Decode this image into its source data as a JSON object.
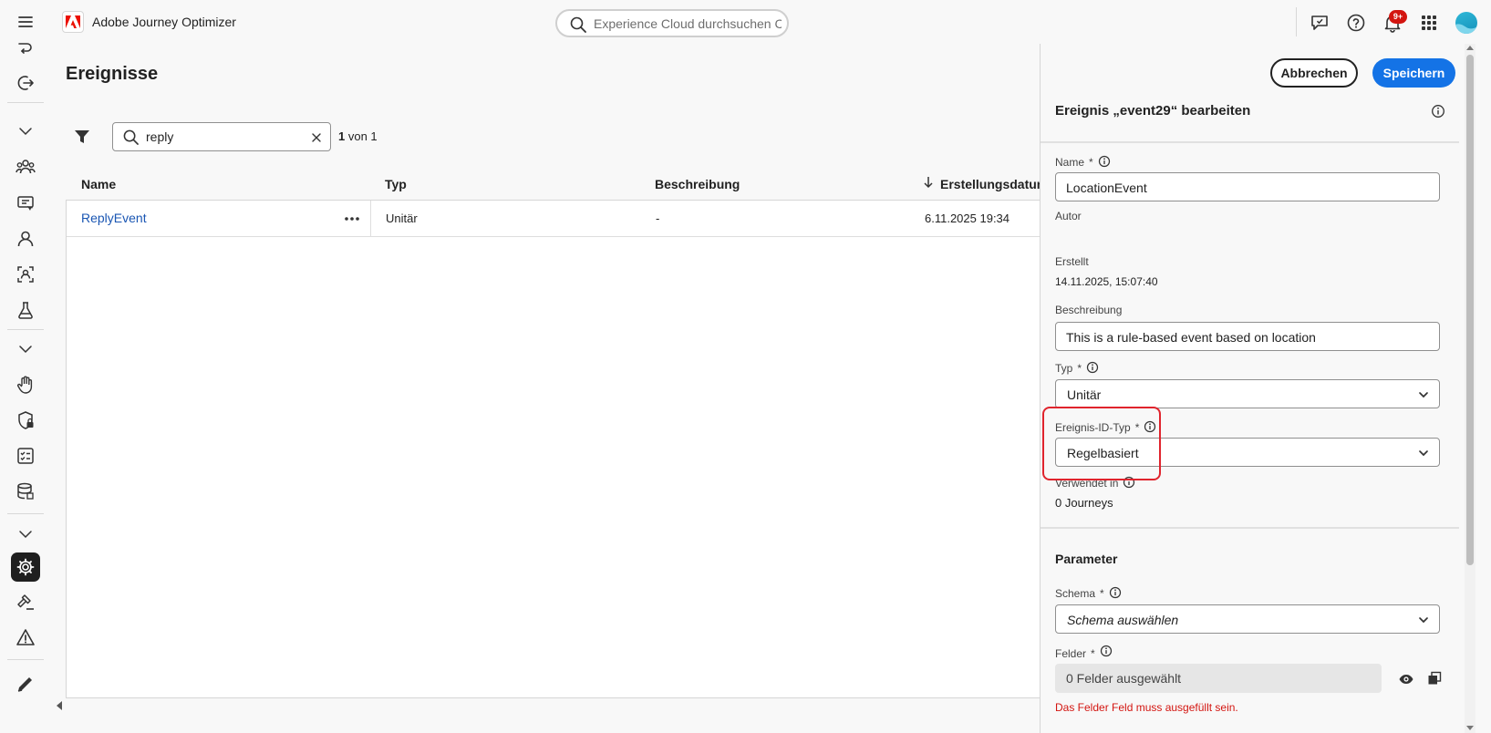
{
  "header": {
    "app_title": "Adobe Journey Optimizer",
    "search_placeholder": "Experience Cloud durchsuchen Ctr...",
    "notification_badge": "9+",
    "icons": [
      "hamburger-menu-icon",
      "adobe-logo-icon",
      "search-icon",
      "feedback-icon",
      "help-icon",
      "bell-icon",
      "apps-grid-icon",
      "user-avatar"
    ]
  },
  "rail": {
    "icons": [
      "journey-icon",
      "exit-icon",
      "chevron-down-icon",
      "audiences-icon",
      "offers-icon",
      "profile-icon",
      "identity-icon",
      "experiment-icon",
      "chevron-down-icon",
      "hand-icon",
      "privacy-shield-icon",
      "checklist-icon",
      "datasets-icon",
      "chevron-down-icon",
      "settings-gear-icon",
      "hammer-icon",
      "alert-icon",
      "edit-pencil-icon"
    ],
    "active_item": "settings-gear-icon"
  },
  "main": {
    "page_title": "Ereignisse",
    "filter": {
      "search_value": "reply",
      "count_current": "1",
      "count_suffix": "von 1"
    },
    "table": {
      "columns": [
        "Name",
        "Typ",
        "Beschreibung",
        "Erstellungsdatum"
      ],
      "sorted_column": "Erstellungsdatum",
      "sort_direction": "descending",
      "rows": [
        {
          "name": "ReplyEvent",
          "type": "Unitär",
          "description": "-",
          "created": "6.11.2025 19:34"
        }
      ]
    }
  },
  "panel": {
    "cancel_label": "Abbrechen",
    "save_label": "Speichern",
    "heading": "Ereignis „event29“ bearbeiten",
    "name_label": "Name",
    "name_value": "LocationEvent",
    "author_label": "Autor",
    "author_value": "",
    "created_label": "Erstellt",
    "created_value": "14.11.2025, 15:07:40",
    "description_label": "Beschreibung",
    "description_value": "This is a rule-based event based on location",
    "type_label": "Typ",
    "type_value": "Unitär",
    "event_id_type_label": "Ereignis-ID-Typ",
    "event_id_type_value": "Regelbasiert",
    "used_in_label": "Verwendet in",
    "used_in_value": "0 Journeys",
    "parameters_title": "Parameter",
    "schema_label": "Schema",
    "schema_placeholder": "Schema auswählen",
    "fields_label": "Felder",
    "fields_value": "0 Felder ausgewählt",
    "fields_error": "Das Felder Feld muss ausgefüllt sein.",
    "required_marker": "*"
  },
  "colors": {
    "accent_blue": "#1473e6",
    "link_blue": "#1a56b3",
    "error_red": "#d31510",
    "highlight_red": "#e0242d",
    "background": "#f8f8f8"
  }
}
